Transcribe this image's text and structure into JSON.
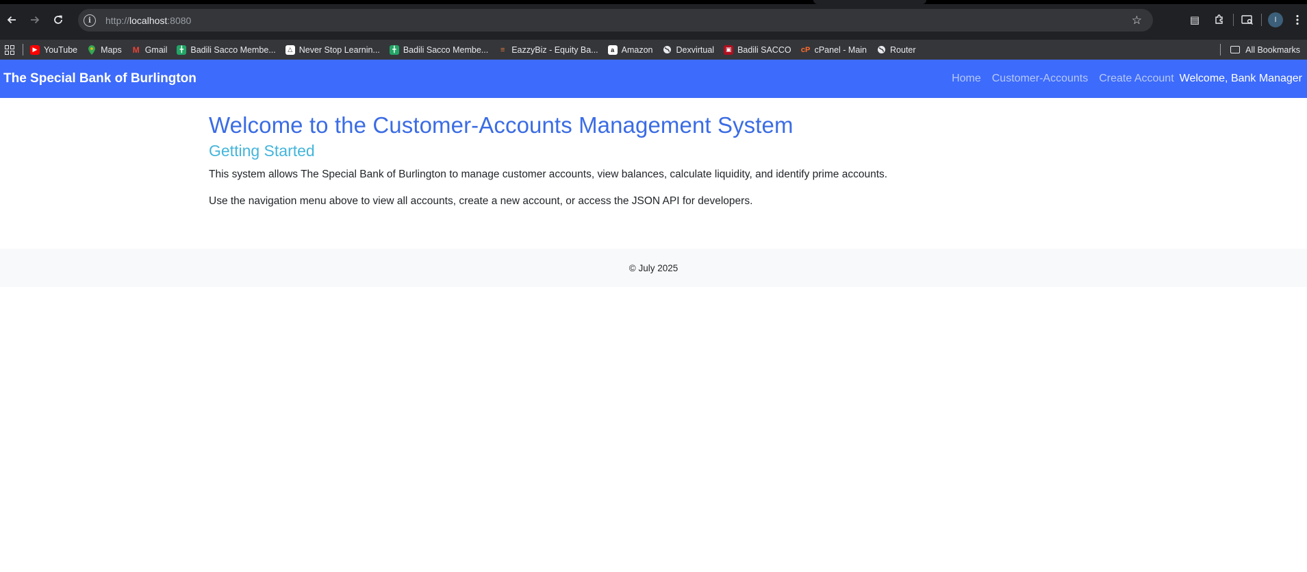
{
  "browser": {
    "url_scheme": "http://",
    "url_host": "localhost",
    "url_port": ":8080",
    "profile_initial": "I",
    "bookmarks": [
      {
        "label": "YouTube",
        "icon": "youtube-icon",
        "color": "#ff0000"
      },
      {
        "label": "Maps",
        "icon": "maps-pin-icon",
        "color": "#34a853"
      },
      {
        "label": "Gmail",
        "icon": "gmail-icon",
        "color": "#ea4335"
      },
      {
        "label": "Badili Sacco Membe...",
        "icon": "sheets-icon",
        "color": "#23a566"
      },
      {
        "label": "Never Stop Learnin...",
        "icon": "triangle-logo-icon",
        "color": "#ffffff"
      },
      {
        "label": "Badili Sacco Membe...",
        "icon": "sheets-icon",
        "color": "#23a566"
      },
      {
        "label": "EazzyBiz - Equity Ba...",
        "icon": "equity-icon",
        "color": "#a32a22"
      },
      {
        "label": "Amazon",
        "icon": "amazon-icon",
        "color": "#ffffff"
      },
      {
        "label": "Dexvirtual",
        "icon": "globe-icon",
        "color": "#e8eaed"
      },
      {
        "label": "Badili SACCO",
        "icon": "badili-icon",
        "color": "#b01020"
      },
      {
        "label": "cPanel - Main",
        "icon": "cpanel-icon",
        "color": "#ff6c2c"
      },
      {
        "label": "Router",
        "icon": "globe-icon",
        "color": "#e8eaed"
      }
    ],
    "all_bookmarks_label": "All Bookmarks"
  },
  "navbar": {
    "brand": "The Special Bank of Burlington",
    "links": [
      "Home",
      "Customer-Accounts",
      "Create Account"
    ],
    "welcome": "Welcome, Bank Manager"
  },
  "main": {
    "heading": "Welcome to the Customer-Accounts Management System",
    "subheading": "Getting Started",
    "paragraph1": "This system allows The Special Bank of Burlington to manage customer accounts, view balances, calculate liquidity, and identify prime accounts.",
    "paragraph2": "Use the navigation menu above to view all accounts, create a new account, or access the JSON API for developers."
  },
  "footer": {
    "text": "© July 2025"
  },
  "colors": {
    "navbar_bg": "#3d6bfb",
    "heading": "#3b6ce4",
    "subheading": "#44b5db",
    "footer_bg": "#f8f9fa"
  }
}
